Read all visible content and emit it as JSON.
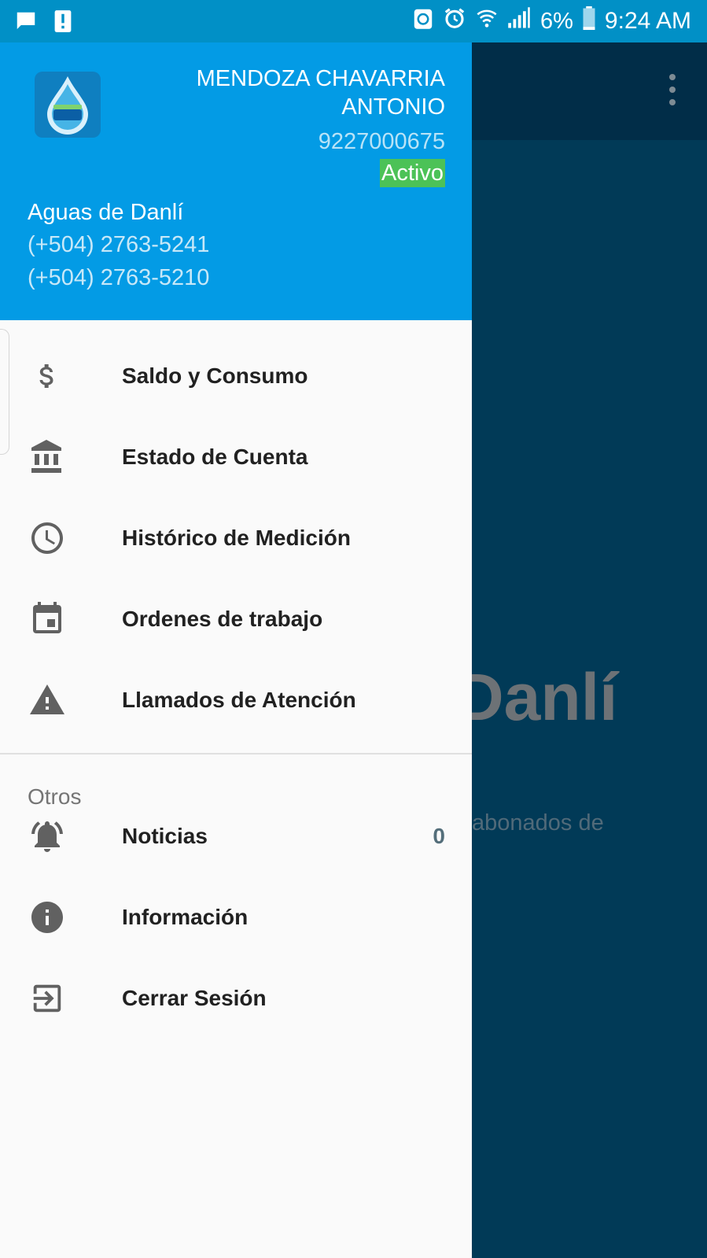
{
  "status_bar": {
    "left_icons": [
      "message-icon",
      "alert-icon"
    ],
    "right_icons": [
      "sync-icon",
      "alarm-icon",
      "wifi-icon",
      "signal-icon",
      "battery-icon"
    ],
    "battery": "6%",
    "time": "9:24 AM"
  },
  "drawer": {
    "user": {
      "name_line1": "MENDOZA CHAVARRIA",
      "name_line2": "ANTONIO",
      "account": "9227000675",
      "status": "Activo"
    },
    "org": {
      "name": "Aguas de Danlí",
      "phone1": "(+504) 2763-5241",
      "phone2": "(+504) 2763-5210"
    },
    "menu": [
      {
        "label": "Saldo y Consumo",
        "icon": "dollar-icon"
      },
      {
        "label": "Estado de Cuenta",
        "icon": "bank-icon"
      },
      {
        "label": "Histórico de Medición",
        "icon": "clock-icon"
      },
      {
        "label": "Ordenes de trabajo",
        "icon": "calendar-icon"
      },
      {
        "label": "Llamados de Atención",
        "icon": "warning-icon"
      }
    ],
    "section_title": "Otros",
    "others": [
      {
        "label": "Noticias",
        "icon": "bell-icon",
        "count": "0"
      },
      {
        "label": "Información",
        "icon": "info-icon"
      },
      {
        "label": "Cerrar Sesión",
        "icon": "logout-icon"
      }
    ]
  },
  "background": {
    "title_fragment": "Danlí",
    "subtitle_fragment": "abonados de"
  },
  "colors": {
    "header": "#039be5",
    "status_bar": "#0190c6",
    "active_badge": "#4cc257",
    "icon": "#616161",
    "backdrop": "#013a57"
  }
}
